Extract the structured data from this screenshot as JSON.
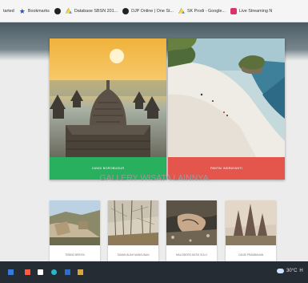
{
  "bookmarks": [
    {
      "label": "tarted",
      "icon": "none"
    },
    {
      "label": "Bookmarks",
      "icon": "star-icon"
    },
    {
      "label": "",
      "icon": "github-icon"
    },
    {
      "label": "Database SBSN 201...",
      "icon": "drive-icon"
    },
    {
      "label": "DJP Online | One St...",
      "icon": "github-icon"
    },
    {
      "label": "SK Prodi - Google...",
      "icon": "drive-icon"
    },
    {
      "label": "Live Streaming N",
      "icon": "stream-icon"
    }
  ],
  "cards": [
    {
      "button": "Candi Borobudur",
      "scene": "borobudur-temple"
    },
    {
      "button": "Pantai Indrayanti",
      "scene": "white-sand-beach"
    }
  ],
  "gallery": {
    "title": "GALLERY WISATA LAINNYA",
    "items": [
      {
        "caption": "Tebing Breksi",
        "scene": "stone-cliff"
      },
      {
        "caption": "Taman Buah Mangunan",
        "scene": "pine-forest"
      },
      {
        "caption": "Malioboro Batik Solo",
        "scene": "batik-hands"
      },
      {
        "caption": "Candi Prambanan",
        "scene": "prambanan-temple"
      }
    ]
  },
  "taskbar": {
    "temperature": "30°C",
    "trailing": "H"
  },
  "colors": {
    "green": "#29b05e",
    "red": "#e4564c",
    "taskbar": "#252c34"
  }
}
